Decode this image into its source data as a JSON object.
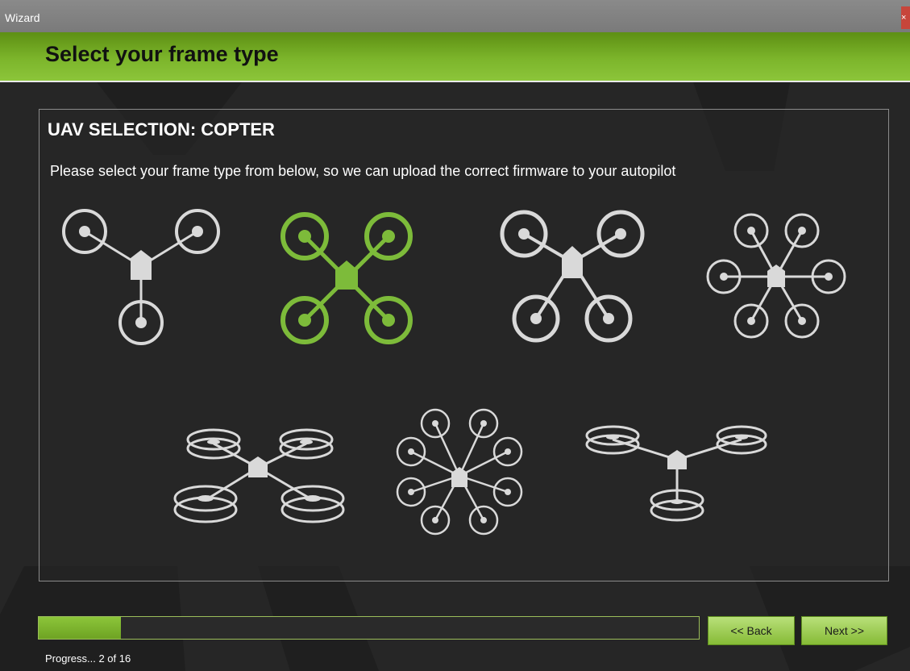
{
  "window": {
    "title": "Wizard",
    "close_label": "×"
  },
  "header": {
    "title": "Select your frame type"
  },
  "panel": {
    "heading": "UAV SELECTION: COPTER",
    "description": "Please select your frame type from below, so we can upload the correct firmware to your autopilot"
  },
  "frames": [
    {
      "name": "tricopter",
      "selected": false
    },
    {
      "name": "quadcopter-x",
      "selected": true
    },
    {
      "name": "hexacopter",
      "selected": false
    },
    {
      "name": "octocopter",
      "selected": false
    },
    {
      "name": "octa-quad-coaxial",
      "selected": false
    },
    {
      "name": "octocopter-2",
      "selected": false
    },
    {
      "name": "y6-coaxial",
      "selected": false
    }
  ],
  "progress": {
    "current": 2,
    "total": 16,
    "label": "Progress... 2 of 16"
  },
  "buttons": {
    "back": "<< Back",
    "next": "Next >>"
  },
  "colors": {
    "accent": "#7cb52b",
    "selected_frame": "#7dbb3a",
    "frame": "#d9d9d9",
    "background": "#262626"
  }
}
